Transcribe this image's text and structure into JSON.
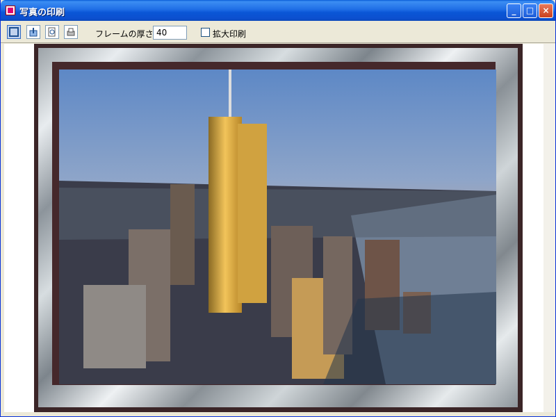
{
  "window": {
    "title": "写真の印刷",
    "controls": {
      "minimize": "_",
      "maximize": "□",
      "close": "×"
    }
  },
  "toolbar": {
    "tools": [
      "fit-page-icon",
      "printer-setup-icon",
      "print-preview-icon",
      "printer-icon"
    ],
    "frame_label": "フレームの厚さ:",
    "frame_value": "40",
    "enlarge_label": "拡大印刷",
    "enlarge_checked": false
  },
  "colors": {
    "titlebar": "#0a56d6",
    "toolbar": "#ece9d8",
    "frame_dark": "#3b2527",
    "frame_silver": "#c9cfd3"
  }
}
